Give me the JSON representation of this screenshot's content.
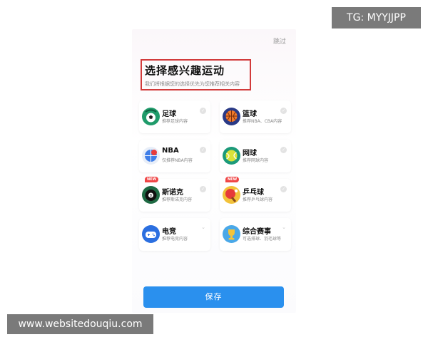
{
  "header": {
    "skip_label": "跳过",
    "title": "选择感兴趣运动",
    "subtitle": "我们将根据您的选择优先为您推荐相关内容"
  },
  "sports": [
    {
      "name": "足球",
      "desc": "推荐足球内容",
      "icon": "soccer-icon",
      "is_new": false
    },
    {
      "name": "篮球",
      "desc": "推荐NBA、CBA内容",
      "icon": "basketball-icon",
      "is_new": false
    },
    {
      "name": "NBA",
      "desc": "仅推荐NBA内容",
      "icon": "nba-icon",
      "is_new": false
    },
    {
      "name": "网球",
      "desc": "推荐网球内容",
      "icon": "tennis-icon",
      "is_new": false
    },
    {
      "name": "斯诺克",
      "desc": "推荐斯诺克内容",
      "icon": "snooker-icon",
      "is_new": true
    },
    {
      "name": "乒乓球",
      "desc": "推荐乒乓球内容",
      "icon": "table-tennis-icon",
      "is_new": true
    },
    {
      "name": "电竞",
      "desc": "推荐电竞内容",
      "icon": "esports-icon",
      "is_new": false
    },
    {
      "name": "综合赛事",
      "desc": "可选排球、羽毛球等",
      "icon": "trophy-icon",
      "is_new": false
    }
  ],
  "new_badge": "NEW",
  "save_label": "保存",
  "watermarks": {
    "top": "TG: MYYJJPP",
    "bottom": "www.websitedouqiu.com"
  },
  "colors": {
    "accent": "#2a90ee",
    "highlight_box": "#d23b3b",
    "new_badge": "#f04646"
  }
}
